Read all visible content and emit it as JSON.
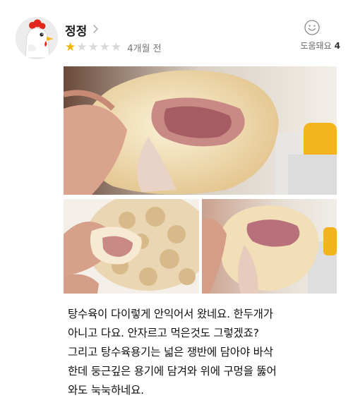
{
  "reviewer": {
    "name": "정정",
    "rating": 1,
    "max_rating": 5,
    "time_ago": "4개월 전",
    "avatar_icon": "chicken-avatar-icon"
  },
  "helpful": {
    "icon": "smiley-icon",
    "label": "도움돼요",
    "count": "4"
  },
  "photos": [
    {
      "name": "fried-pork-closeup-photo"
    },
    {
      "name": "fried-pork-bowl-photo"
    },
    {
      "name": "fried-pork-bite-photo"
    }
  ],
  "review": {
    "lines": [
      "탕수육이 다이렇게 안익어서 왔네요. 한두개가",
      "아니고 다요. 안자르고 먹은것도 그렇겠죠?",
      "그리고 탕수육용기는 넓은 쟁반에 담아야 바삭",
      "한데 둥근깊은 용기에 담겨와 위에 구멍을 뚫어",
      "와도 눅눅하네요."
    ]
  },
  "colors": {
    "star_on": "#f2b600",
    "star_off": "#d9d9d9",
    "avatar_bg": "#ececec"
  }
}
